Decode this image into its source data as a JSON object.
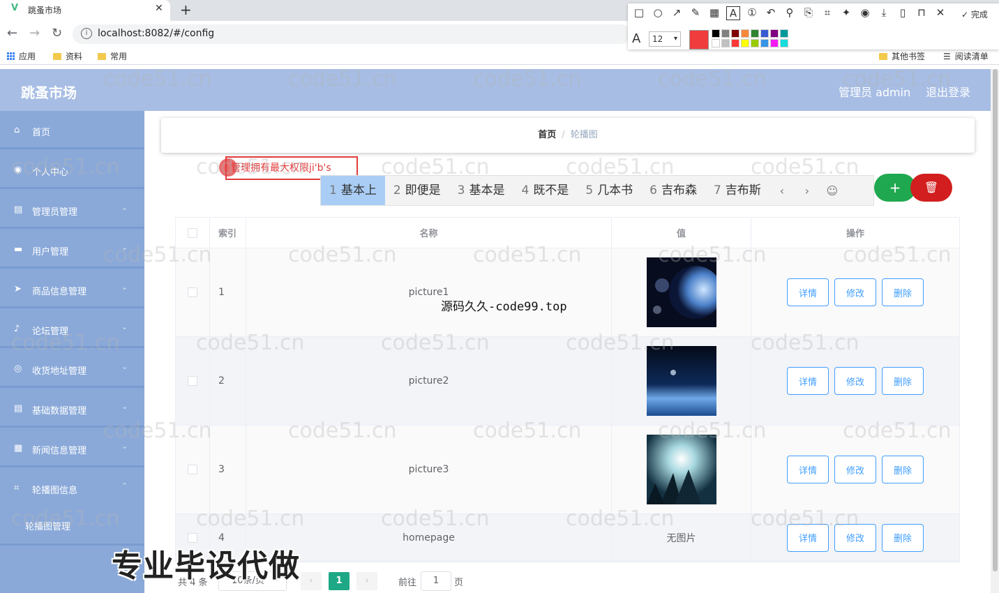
{
  "browser": {
    "tab_title": "跳蚤市场",
    "url": "localhost:8082/#/config",
    "bookmarks": [
      "应用",
      "资料",
      "常用"
    ],
    "other_bookmarks": "其他书签",
    "reading_list": "阅读清单",
    "screenshot_tool": {
      "done_label": "完成",
      "font_size": "12"
    }
  },
  "header": {
    "title": "跳蚤市场",
    "admin": "管理员 admin",
    "logout": "退出登录"
  },
  "sidebar": {
    "items": [
      {
        "label": "首页",
        "icon": "home-icon"
      },
      {
        "label": "个人中心",
        "icon": "user-icon"
      },
      {
        "label": "管理员管理",
        "icon": "list-icon"
      },
      {
        "label": "用户管理",
        "icon": "users-icon"
      },
      {
        "label": "商品信息管理",
        "icon": "send-icon"
      },
      {
        "label": "论坛管理",
        "icon": "mic-icon"
      },
      {
        "label": "收货地址管理",
        "icon": "compass-icon"
      },
      {
        "label": "基础数据管理",
        "icon": "list-icon"
      },
      {
        "label": "新闻信息管理",
        "icon": "news-icon"
      },
      {
        "label": "轮播图信息",
        "icon": "crop-icon"
      }
    ],
    "sub_item": "轮播图管理"
  },
  "breadcrumb": {
    "home": "首页",
    "sep": "/",
    "current": "轮播图"
  },
  "search": {
    "value": "管理拥有最大权限ji'b's"
  },
  "ime": {
    "candidates": [
      {
        "num": "1",
        "text": "基本上"
      },
      {
        "num": "2",
        "text": "即便是"
      },
      {
        "num": "3",
        "text": "基本是"
      },
      {
        "num": "4",
        "text": "既不是"
      },
      {
        "num": "5",
        "text": "几本书"
      },
      {
        "num": "6",
        "text": "吉布森"
      },
      {
        "num": "7",
        "text": "吉布斯"
      }
    ]
  },
  "table": {
    "headers": {
      "index": "索引",
      "name": "名称",
      "value": "值",
      "ops": "操作"
    },
    "rows": [
      {
        "index": "1",
        "name": "picture1",
        "value": ""
      },
      {
        "index": "2",
        "name": "picture2",
        "value": ""
      },
      {
        "index": "3",
        "name": "picture3",
        "value": ""
      },
      {
        "index": "4",
        "name": "homepage",
        "value": "无图片"
      }
    ],
    "op_labels": {
      "detail": "详情",
      "edit": "修改",
      "delete": "删除"
    }
  },
  "pagination": {
    "total": "共 4 条",
    "page_size": "10条/页",
    "current": "1",
    "goto_prefix": "前往",
    "goto_value": "1",
    "goto_suffix": "页"
  },
  "watermarks": {
    "tile": "code51.cn",
    "center": "源码久久-code99.top",
    "bottom": "专业毕设代做"
  },
  "colors": {
    "header": "#a7bde4",
    "sidebar": "#8aa9d9",
    "add": "#1fa84f",
    "delete": "#d21e1e",
    "primary": "#409eff",
    "pager_active": "#1fa885"
  }
}
